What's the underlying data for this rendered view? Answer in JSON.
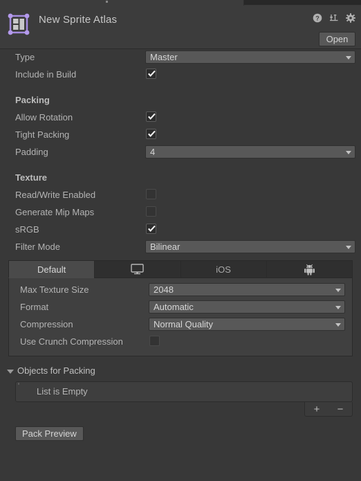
{
  "header": {
    "title": "New Sprite Atlas",
    "icon": "sprite-atlas-icon",
    "help_icon": "help-icon",
    "preset_icon": "preset-icon",
    "gear_icon": "gear-icon",
    "open_label": "Open"
  },
  "general": {
    "type": {
      "label": "Type",
      "value": "Master"
    },
    "include_in_build": {
      "label": "Include in Build",
      "checked": true
    }
  },
  "packing": {
    "section_label": "Packing",
    "allow_rotation": {
      "label": "Allow Rotation",
      "checked": true
    },
    "tight_packing": {
      "label": "Tight Packing",
      "checked": true
    },
    "padding": {
      "label": "Padding",
      "value": "4"
    }
  },
  "texture": {
    "section_label": "Texture",
    "read_write_enabled": {
      "label": "Read/Write Enabled",
      "checked": false
    },
    "generate_mip_maps": {
      "label": "Generate Mip Maps",
      "checked": false
    },
    "srgb": {
      "label": "sRGB",
      "checked": true
    },
    "filter_mode": {
      "label": "Filter Mode",
      "value": "Bilinear"
    }
  },
  "platform_tabs": [
    {
      "label": "Default",
      "icon": "",
      "active": true
    },
    {
      "label": "",
      "icon": "monitor-icon",
      "active": false
    },
    {
      "label": "iOS",
      "icon": "",
      "active": false
    },
    {
      "label": "",
      "icon": "android-icon",
      "active": false
    }
  ],
  "platform_settings": {
    "max_texture_size": {
      "label": "Max Texture Size",
      "value": "2048"
    },
    "format": {
      "label": "Format",
      "value": "Automatic"
    },
    "compression": {
      "label": "Compression",
      "value": "Normal Quality"
    },
    "use_crunch_compression": {
      "label": "Use Crunch Compression",
      "checked": false
    }
  },
  "objects_for_packing": {
    "label": "Objects for Packing",
    "empty_text": "List is Empty",
    "add_label": "+",
    "remove_label": "−"
  },
  "pack_preview": {
    "label": "Pack Preview"
  },
  "colors": {
    "background": "#383838",
    "header_bg": "#3c3c3c",
    "control_bg": "#585858",
    "panel_bg": "#404040",
    "accent": "#a08cd8",
    "text": "#b4b4b4"
  }
}
